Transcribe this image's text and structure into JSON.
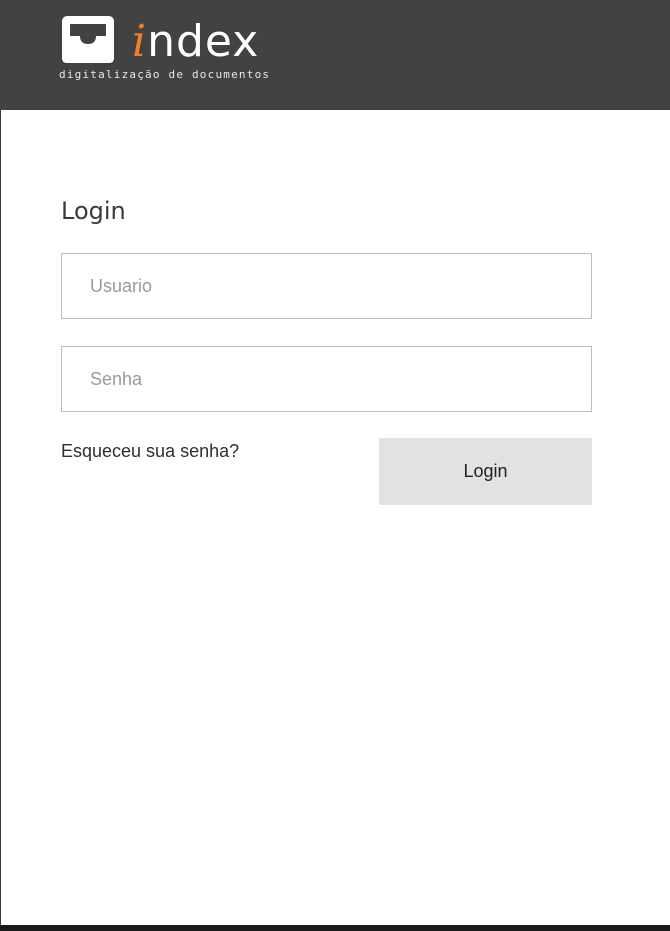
{
  "header": {
    "logo": {
      "brand_accent_letter": "i",
      "brand_rest": "ndex",
      "tagline": "digitalização de documentos",
      "accent_color": "#f07f2a",
      "icon": "inbox-tray-icon"
    },
    "background_color": "#424242"
  },
  "form": {
    "title": "Login",
    "username": {
      "value": "",
      "placeholder": "Usuario"
    },
    "password": {
      "value": "",
      "placeholder": "Senha"
    },
    "forgot_label": "Esqueceu sua senha?",
    "submit_label": "Login",
    "button_color": "#e2e2e2"
  }
}
